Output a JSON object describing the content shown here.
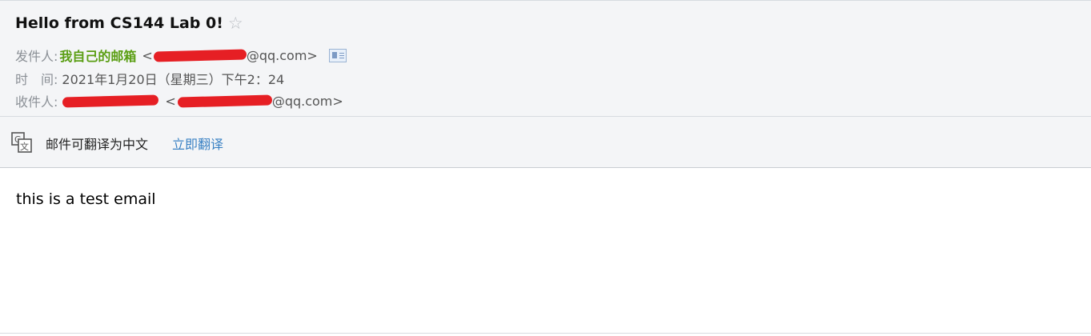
{
  "mail": {
    "subject": "Hello from CS144 Lab 0!",
    "star_icon": "star-outline-icon",
    "from_label": "发件人:",
    "from_name": "我自己的邮箱",
    "from_addr_open": "<",
    "from_addr_domain": "@qq.com>",
    "time_label": "时　间:",
    "time_value": "2021年1月20日（星期三）下午2：24",
    "to_label": "收件人:",
    "to_addr_open": "<",
    "to_addr_domain": "@qq.com>",
    "redaction_color": "#e61f24"
  },
  "translate": {
    "icon": "translate-icon",
    "text": "邮件可翻译为中文",
    "link": "立即翻译",
    "link_color": "#3b82c4"
  },
  "body": {
    "text": "this is a test email"
  }
}
